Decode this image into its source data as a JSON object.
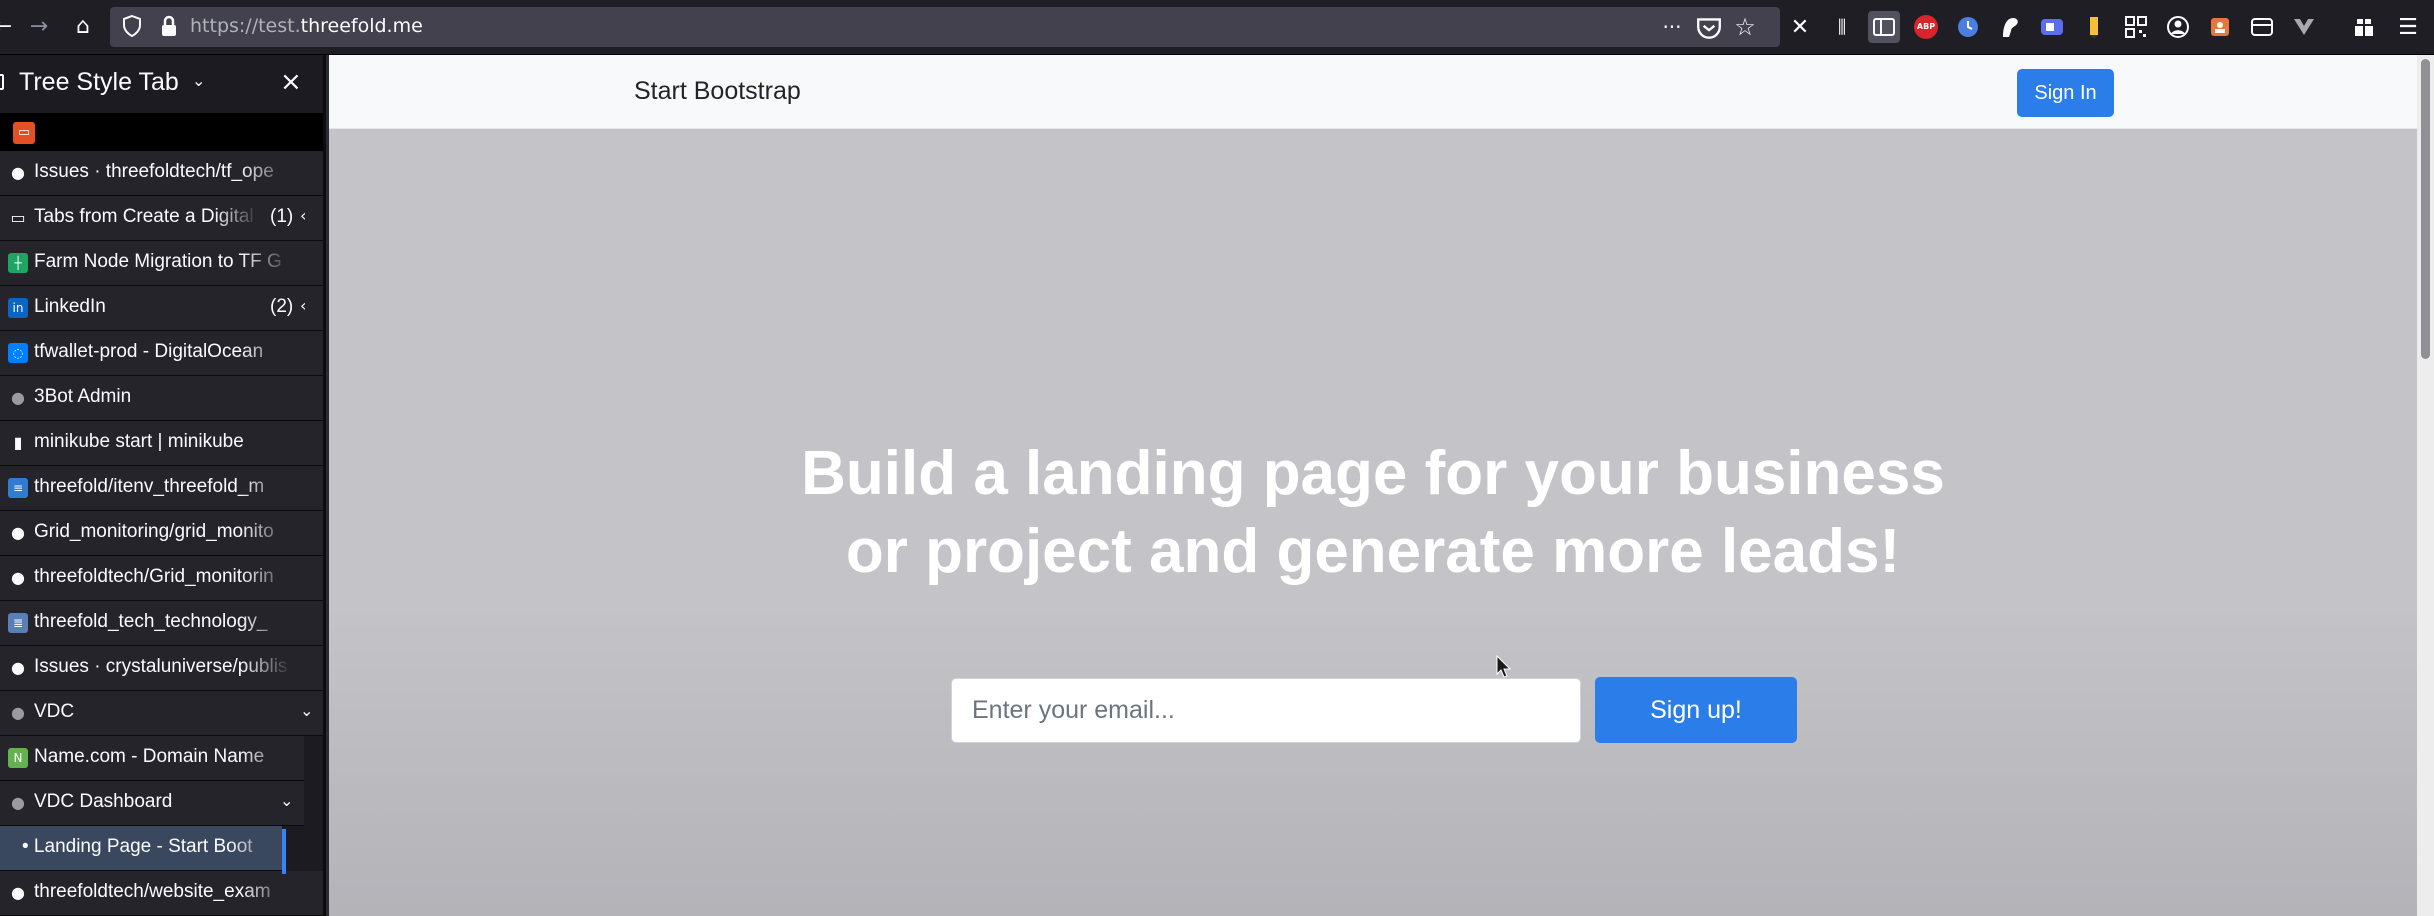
{
  "browser": {
    "url_prefix": "https://test.",
    "url_domain": "threefold.me",
    "back_glyph": "←",
    "forward_glyph": "→",
    "home_glyph": "⌂",
    "overflow_glyph": "···",
    "star_glyph": "☆",
    "close_glyph": "✕",
    "library_glyph": "⫼",
    "menu_glyph": "☰",
    "abp_label": "ABP"
  },
  "sidebar": {
    "title": "Tree Style Tab",
    "chevron": "⌄",
    "close": "×",
    "pinned_glyph": "▭",
    "tabs": [
      {
        "title": "Issues · threefoldtech/tf_ope",
        "icon": "github-icon",
        "color": "#fbfbfe",
        "glyph": "●"
      },
      {
        "title": "Tabs from Create a Digital",
        "count": "(1)",
        "twisty": "‹",
        "icon": "folder-icon",
        "color": "#fbfbfe",
        "glyph": "▭"
      },
      {
        "title": "Farm Node Migration to TF G",
        "icon": "sheets-icon",
        "color": "#1fa463",
        "glyph": "┼"
      },
      {
        "title": "LinkedIn",
        "count": "(2)",
        "twisty": "‹",
        "icon": "linkedin-icon",
        "color": "#0a66c2",
        "glyph": "in"
      },
      {
        "title": "tfwallet-prod - DigitalOcean",
        "icon": "digitalocean-icon",
        "color": "#0080ff",
        "glyph": "◌"
      },
      {
        "title": "3Bot Admin",
        "icon": "3bot-icon",
        "color": "#9a9aa0",
        "glyph": "●"
      },
      {
        "title": "minikube start | minikube",
        "icon": "page-icon",
        "color": "#fbfbfe",
        "glyph": "▮"
      },
      {
        "title": "threefold/itenv_threefold_m",
        "icon": "gitea-icon",
        "color": "#2f7dd1",
        "glyph": "≡"
      },
      {
        "title": "Grid_monitoring/grid_monito",
        "icon": "github-icon",
        "color": "#fbfbfe",
        "glyph": "●"
      },
      {
        "title": "threefoldtech/Grid_monitorin",
        "icon": "github-icon",
        "color": "#fbfbfe",
        "glyph": "●"
      },
      {
        "title": "threefold_tech_technology_",
        "icon": "doc-icon",
        "color": "#5a7fb5",
        "glyph": "≣"
      },
      {
        "title": "Issues · crystaluniverse/publis",
        "icon": "github-icon",
        "color": "#fbfbfe",
        "glyph": "●"
      },
      {
        "title": "VDC",
        "twisty": "⌄",
        "icon": "3bot-icon",
        "color": "#9a9aa0",
        "glyph": "●"
      },
      {
        "title": "Name.com - Domain Name",
        "icon": "namecom-icon",
        "color": "#62b34f",
        "glyph": "N"
      },
      {
        "title": "VDC Dashboard",
        "twisty": "⌄",
        "icon": "3bot-icon",
        "color": "#9a9aa0",
        "glyph": "●"
      },
      {
        "title": "• Landing Page - Start Boot",
        "icon": "none",
        "color": "#39485e",
        "glyph": ""
      },
      {
        "title": "threefoldtech/website_exam",
        "icon": "github-icon",
        "color": "#fbfbfe",
        "glyph": "●"
      }
    ]
  },
  "page": {
    "brand": "Start Bootstrap",
    "signin_label": "Sign In",
    "headline_line1": "Build a landing page for your business",
    "headline_line2": "or project and generate more leads!",
    "email_placeholder": "Enter your email...",
    "signup_label": "Sign up!"
  },
  "colors": {
    "accent": "#2b7de9",
    "hero_bg": "#c4c4c8",
    "sidebar_bg": "#25242b",
    "active_tab": "#39485e"
  }
}
